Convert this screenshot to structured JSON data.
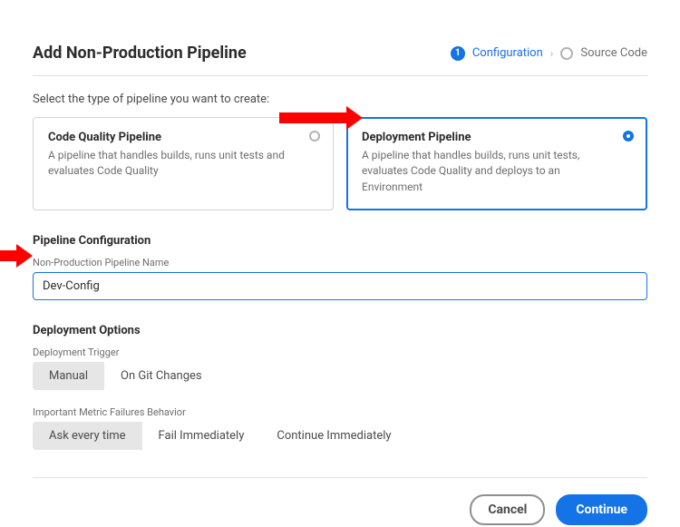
{
  "header": {
    "title": "Add Non-Production Pipeline",
    "steps": [
      {
        "num": "1",
        "label": "Configuration",
        "active": true
      },
      {
        "label": "Source Code",
        "active": false
      }
    ]
  },
  "prompt": "Select the type of pipeline you want to create:",
  "cards": {
    "code_quality": {
      "title": "Code Quality Pipeline",
      "desc": "A pipeline that handles builds, runs unit tests and evaluates Code Quality"
    },
    "deployment": {
      "title": "Deployment Pipeline",
      "desc": "A pipeline that handles builds, runs unit tests, evaluates Code Quality and deploys to an Environment"
    }
  },
  "config": {
    "heading": "Pipeline Configuration",
    "name_label": "Non-Production Pipeline Name",
    "name_value": "Dev-Config"
  },
  "deploy": {
    "heading": "Deployment Options",
    "trigger_label": "Deployment Trigger",
    "trigger_options": {
      "manual": "Manual",
      "git": "On Git Changes"
    },
    "metrics_label": "Important Metric Failures Behavior",
    "metrics_options": {
      "ask": "Ask every time",
      "fail": "Fail Immediately",
      "cont": "Continue Immediately"
    }
  },
  "footer": {
    "cancel": "Cancel",
    "continue": "Continue"
  }
}
